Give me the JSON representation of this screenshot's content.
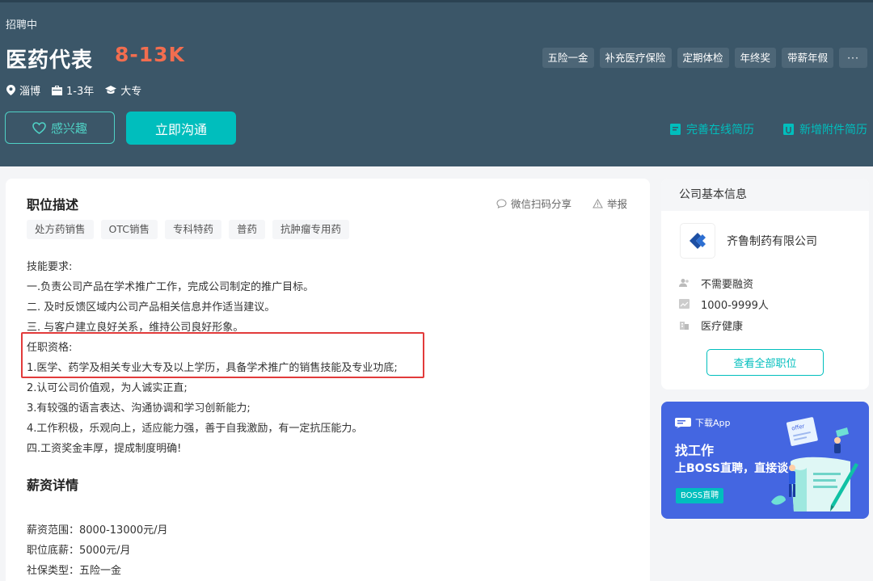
{
  "header": {
    "status": "招聘中",
    "job_title": "医药代表",
    "salary": "8-13K",
    "location": "淄博",
    "experience": "1-3年",
    "education": "大专",
    "benefits": [
      "五险一金",
      "补充医疗保险",
      "定期体检",
      "年终奖",
      "带薪年假"
    ],
    "benefits_more": "···",
    "interest_label": "感兴趣",
    "chat_label": "立即沟通",
    "improve_resume": "完善在线简历",
    "add_attachment": "新增附件简历"
  },
  "job": {
    "section_title": "职位描述",
    "share_wechat": "微信扫码分享",
    "report": "举报",
    "tags": [
      "处方药销售",
      "OTC销售",
      "专科特药",
      "普药",
      "抗肿瘤专用药"
    ],
    "description": [
      "技能要求:",
      "一.负责公司产品在学术推广工作，完成公司制定的推广目标。",
      "二. 及时反馈区域内公司产品相关信息并作适当建议。",
      "三. 与客户建立良好关系，维持公司良好形象。",
      "任职资格:",
      "1.医学、药学及相关专业大专及以上学历，具备学术推广的销售技能及专业功底;",
      "2.认可公司价值观，为人诚实正直;",
      "3.有较强的语言表达、沟通协调和学习创新能力;",
      "4.工作积极，乐观向上，适应能力强，善于自我激励，有一定抗压能力。",
      "四.工资奖金丰厚，提成制度明确!"
    ]
  },
  "salary_details": {
    "section_title": "薪资详情",
    "range": "薪资范围：8000-13000元/月",
    "base": "职位底薪：5000元/月",
    "insurance": "社保类型：五险一金"
  },
  "company": {
    "head": "公司基本信息",
    "name": "齐鲁制药有限公司",
    "financing": "不需要融资",
    "size": "1000-9999人",
    "industry": "医疗健康",
    "view_all_jobs": "查看全部职位"
  },
  "app_promo": {
    "download": "下载App",
    "title": "找工作",
    "subtitle": "上BOSS直聘，直接谈",
    "badge": "BOSS直聘",
    "offer_text": "offer"
  },
  "colors": {
    "header_bg": "#3b5668",
    "accent": "#00bebd",
    "salary": "#f26d4f",
    "highlight": "#e23b3b",
    "promo_bg": "#4466e1"
  }
}
